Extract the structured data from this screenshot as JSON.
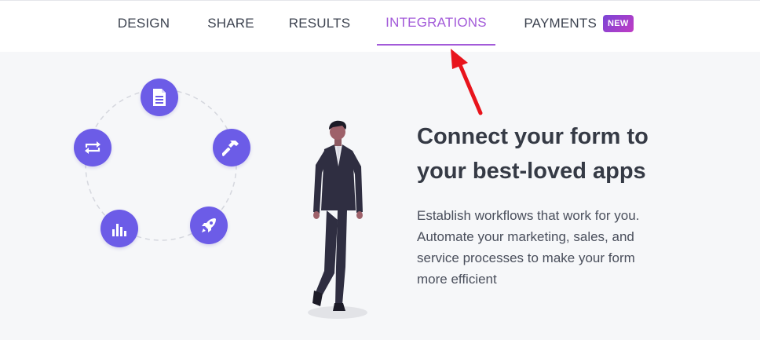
{
  "nav": {
    "tabs": [
      {
        "label": "DESIGN"
      },
      {
        "label": "SHARE"
      },
      {
        "label": "RESULTS"
      },
      {
        "label": "INTEGRATIONS",
        "active": true
      },
      {
        "label": "PAYMENTS",
        "badge": "NEW"
      }
    ],
    "accent_color": "#a35bd9"
  },
  "annotation": {
    "color": "#e8141c",
    "icon": "arrow-pointing-up-left"
  },
  "integration_ring": {
    "icon_color": "#6c5ce7",
    "icons": [
      "document-icon",
      "hammer-icon",
      "rocket-icon",
      "bar-chart-icon",
      "sync-icon"
    ]
  },
  "main": {
    "headline": "Connect your form to your best-loved apps",
    "description": "Establish workflows that work for you. Automate your marketing, sales, and service processes to make your form more efficient"
  }
}
